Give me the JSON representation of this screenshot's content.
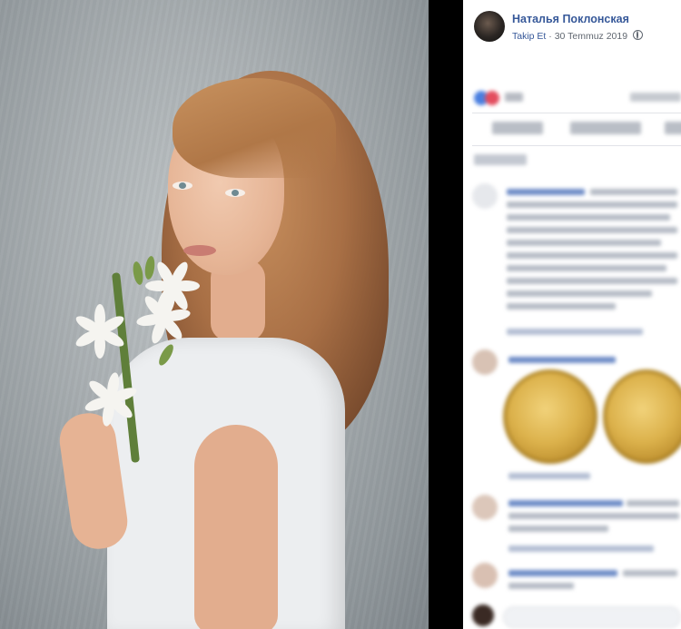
{
  "post": {
    "author_name": "Наталья Поклонская",
    "follow_label": "Takip Et",
    "separator": "·",
    "date": "30 Temmuz 2019",
    "privacy_icon": "globe-icon"
  },
  "colors": {
    "link_blue": "#365899",
    "meta_gray": "#606770",
    "panel_bg": "#ffffff",
    "backdrop": "#000000"
  }
}
